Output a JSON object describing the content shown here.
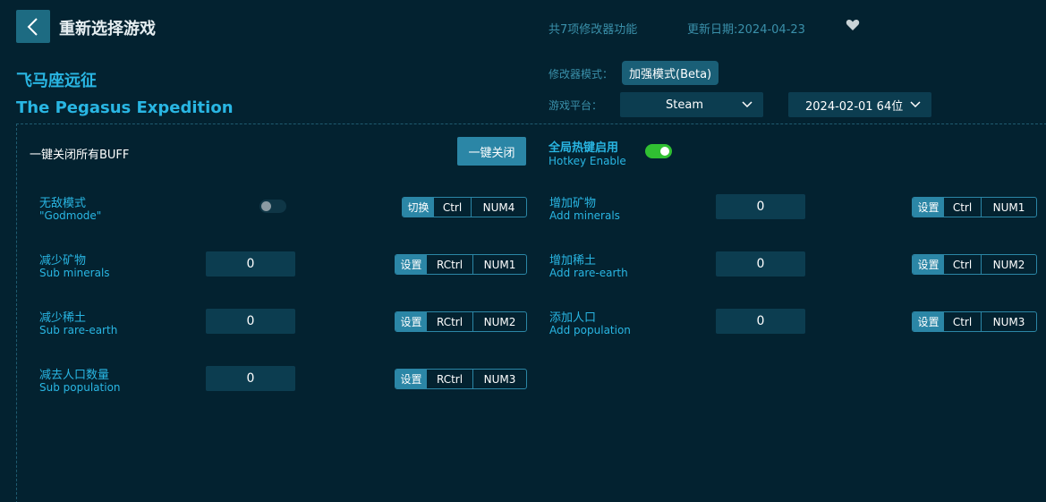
{
  "header": {
    "title": "重新选择游戏",
    "feature_count": "共7项修改器功能",
    "update_date": "更新日期:2024-04-23",
    "back_icon": "chevron-left-icon",
    "favorite_icon": "heart-icon"
  },
  "game": {
    "name_cn": "飞马座远征",
    "name_en": "The Pegasus Expedition"
  },
  "settings": {
    "mode_label": "修改器模式：",
    "mode_value": "加强模式(Beta)",
    "platform_label": "游戏平台：",
    "platform_value": "Steam",
    "version_value": "2024-02-01 64位"
  },
  "global": {
    "close_all_label": "一键关闭所有BUFF",
    "close_all_button": "一键关闭",
    "hotkey_cn": "全局热键启用",
    "hotkey_en": "Hotkey Enable",
    "hotkey_enabled": true
  },
  "options": {
    "godmode": {
      "cn": "无敌模式",
      "en": "\"Godmode\"",
      "enabled": false,
      "action": "切换",
      "key1": "Ctrl",
      "key2": "NUM4"
    },
    "sub_minerals": {
      "cn": "减少矿物",
      "en": "Sub minerals",
      "value": "0",
      "action": "设置",
      "key1": "RCtrl",
      "key2": "NUM1"
    },
    "sub_rare_earth": {
      "cn": "减少稀土",
      "en": "Sub rare-earth",
      "value": "0",
      "action": "设置",
      "key1": "RCtrl",
      "key2": "NUM2"
    },
    "sub_population": {
      "cn": "减去人口数量",
      "en": "Sub population",
      "value": "0",
      "action": "设置",
      "key1": "RCtrl",
      "key2": "NUM3"
    },
    "add_minerals": {
      "cn": "增加矿物",
      "en": "Add minerals",
      "value": "0",
      "action": "设置",
      "key1": "Ctrl",
      "key2": "NUM1"
    },
    "add_rare_earth": {
      "cn": "增加稀土",
      "en": "Add rare-earth",
      "value": "0",
      "action": "设置",
      "key1": "Ctrl",
      "key2": "NUM2"
    },
    "add_population": {
      "cn": "添加人口",
      "en": "Add population",
      "value": "0",
      "action": "设置",
      "key1": "Ctrl",
      "key2": "NUM3"
    }
  },
  "colors": {
    "background": "#032230",
    "accent": "#29b6e3",
    "button": "#2b86a6",
    "toggle_on": "#30c032"
  }
}
